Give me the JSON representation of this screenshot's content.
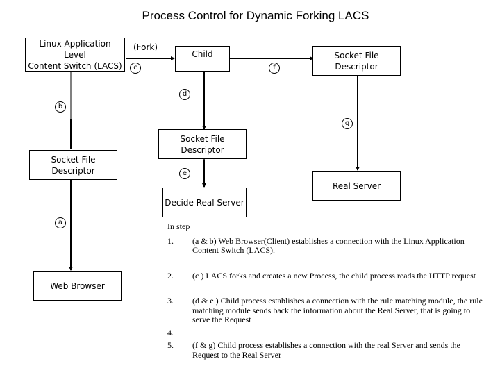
{
  "title": "Process Control for Dynamic Forking LACS",
  "boxes": {
    "lacs": "Linux Application\nLevel\nContent Switch (LACS)",
    "child": "Child",
    "socket_right": "Socket File\nDescriptor",
    "socket_center": "Socket File\nDescriptor",
    "socket_left": "Socket File\nDescriptor",
    "real_server": "Real Server",
    "decide_real_server": "Decide Real Server",
    "web_browser": "Web Browser"
  },
  "edge_labels": {
    "fork": "(Fork)",
    "a": "a",
    "b": "b",
    "c": "c",
    "d": "d",
    "e": "e",
    "f": "f",
    "g": "g"
  },
  "steps": {
    "intro": "In step",
    "items": [
      {
        "num": "1.",
        "text": "(a & b)  Web Browser(Client) establishes a connection with the Linux Application Content Switch (LACS)."
      },
      {
        "num": "2.",
        "text": "(c )   LACS forks and creates a new Process, the child process reads the HTTP request"
      },
      {
        "num": "3.",
        "text": "(d & e ) Child process establishes a connection with the rule matching module, the rule matching module sends back the information about the Real Server, that is going to serve the Request"
      },
      {
        "num": "4.",
        "text": ""
      },
      {
        "num": "5.",
        "text": "(f & g)  Child process establishes a connection with the real Server and sends the Request to the Real Server"
      }
    ]
  }
}
